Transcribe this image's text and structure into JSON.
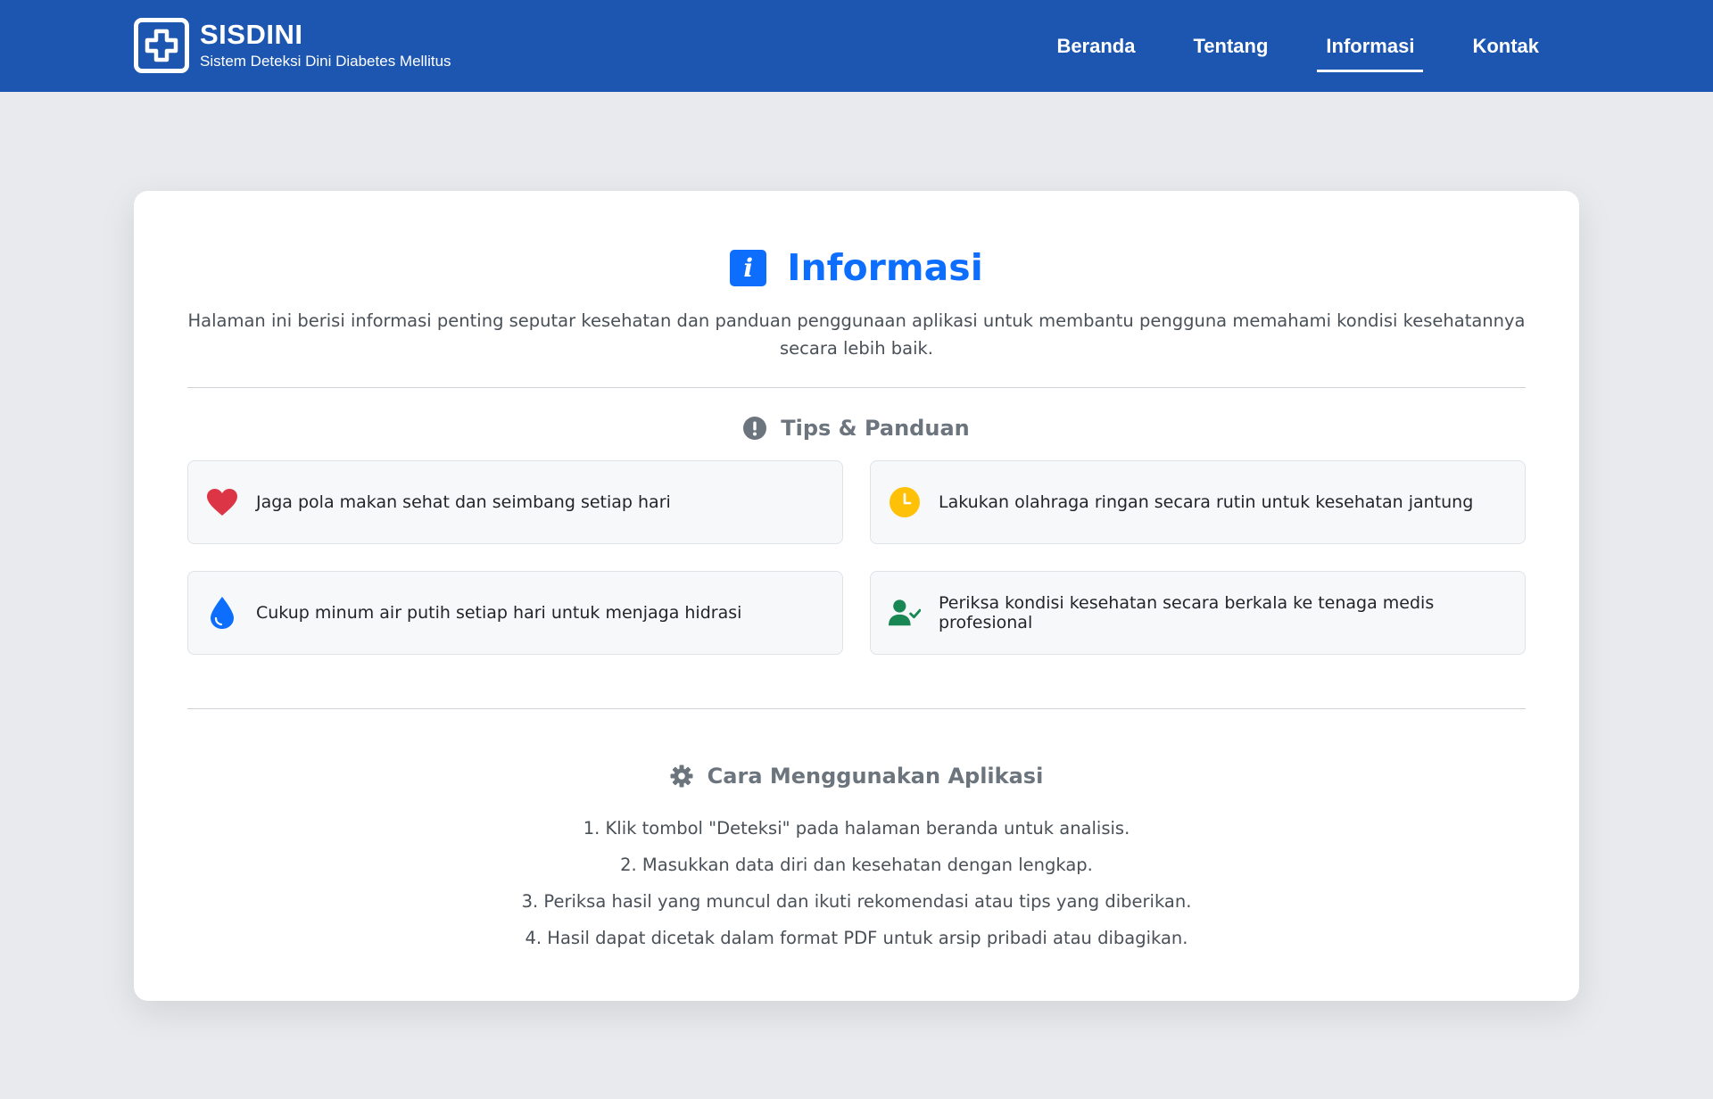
{
  "navbar": {
    "brand_title": "SISDINI",
    "brand_subtitle": "Sistem Deteksi Dini Diabetes Mellitus",
    "links": [
      {
        "label": "Beranda",
        "active": false
      },
      {
        "label": "Tentang",
        "active": false
      },
      {
        "label": "Informasi",
        "active": true
      },
      {
        "label": "Kontak",
        "active": false
      }
    ]
  },
  "page": {
    "title": "Informasi",
    "intro": "Halaman ini berisi informasi penting seputar kesehatan dan panduan penggunaan aplikasi untuk membantu pengguna memahami kondisi kesehatannya secara lebih baik."
  },
  "tips": {
    "heading": "Tips & Panduan",
    "items": [
      {
        "icon": "heart-icon",
        "color": "#dc3545",
        "text": "Jaga pola makan sehat dan seimbang setiap hari"
      },
      {
        "icon": "clock-icon",
        "color": "#ffc107",
        "text": "Lakukan olahraga ringan secara rutin untuk kesehatan jantung"
      },
      {
        "icon": "water-drop-icon",
        "color": "#0d6efd",
        "text": "Cukup minum air putih setiap hari untuk menjaga hidrasi"
      },
      {
        "icon": "user-check-icon",
        "color": "#198754",
        "text": "Periksa kondisi kesehatan secara berkala ke tenaga medis profesional"
      }
    ]
  },
  "guide": {
    "heading": "Cara Menggunakan Aplikasi",
    "steps": [
      "1. Klik tombol \"Deteksi\" pada halaman beranda untuk analisis.",
      "2. Masukkan data diri dan kesehatan dengan lengkap.",
      "3. Periksa hasil yang muncul dan ikuti rekomendasi atau tips yang diberikan.",
      "4. Hasil dapat dicetak dalam format PDF untuk arsip pribadi atau dibagikan."
    ]
  },
  "colors": {
    "navbar_bg": "#1c56b0",
    "accent": "#0d6efd",
    "page_bg": "#e8eaee"
  }
}
